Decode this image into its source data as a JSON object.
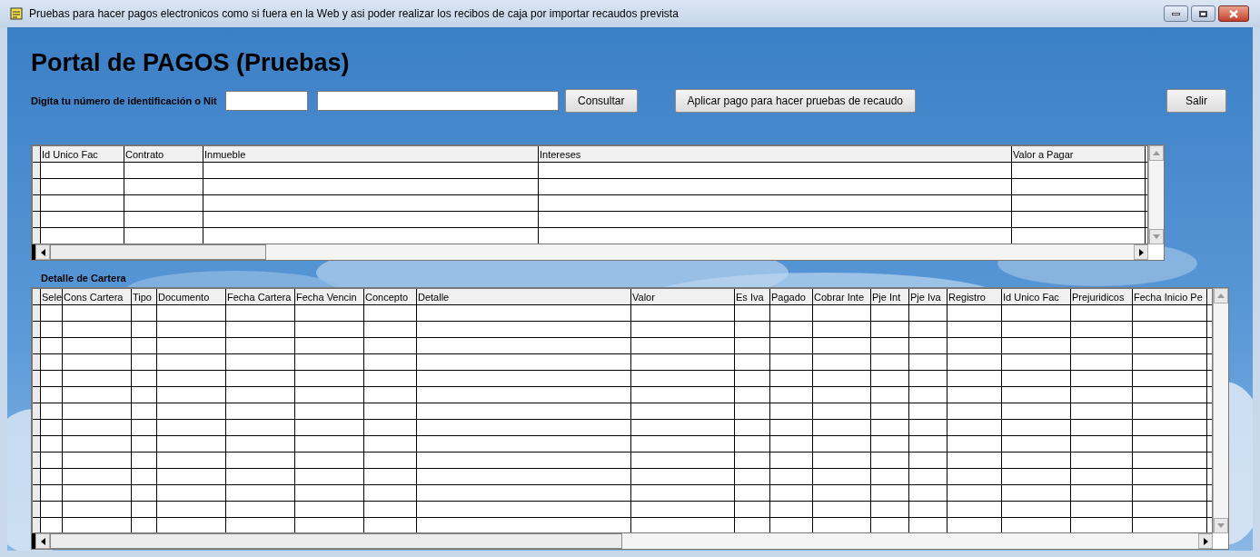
{
  "window": {
    "title": "Pruebas para hacer pagos electronicos como si fuera en la Web y asi poder realizar los recibos de caja por importar recaudos prevista",
    "controls": [
      {
        "kind": "minimize"
      },
      {
        "kind": "maximize"
      },
      {
        "kind": "close"
      }
    ]
  },
  "heading": "Portal de PAGOS (Pruebas)",
  "search": {
    "label": "Digita tu número de identificación o Nit",
    "buttons": [
      "Consultar",
      "Aplicar pago para hacer pruebas de recaudo",
      "Salir"
    ]
  },
  "invoices_table": {
    "columns": [
      "Id Unico Fac",
      "Contrato",
      "Inmueble",
      "Intereses",
      "Valor a Pagar"
    ]
  },
  "detail_title": "Detalle de Cartera",
  "detail_table": {
    "columns": [
      "Sele",
      "Cons Cartera",
      "Tipo",
      "Documento",
      "Fecha Cartera",
      "Fecha Vencin",
      "Concepto",
      "Detalle",
      "Valor",
      "Es Iva",
      "Pagado",
      "Cobrar Inte",
      "Pje Int",
      "Pje Iva",
      "Registro",
      "Id Unico Fac",
      "Prejuridicos",
      "Fecha Inicio Pe"
    ]
  }
}
